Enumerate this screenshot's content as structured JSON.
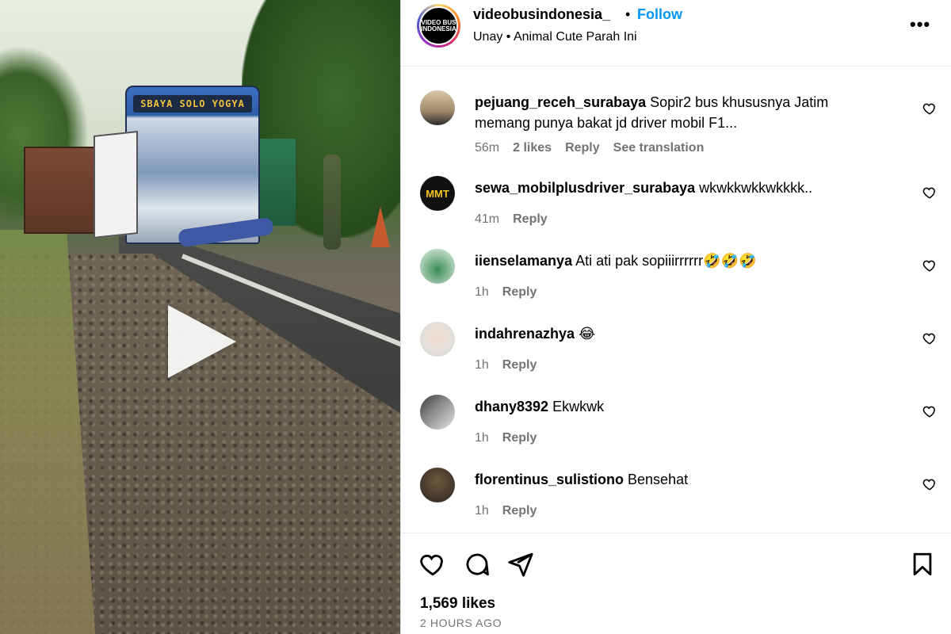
{
  "post": {
    "username": "videobusindonesia_",
    "separator": "•",
    "follow_label": "Follow",
    "audio": "Unay • Animal Cute Parah Ini",
    "avatar_text": "VIDEO BUS INDONESIA",
    "more_label": "•••",
    "bus_sign": "SBAYA SOLO YOGYA"
  },
  "comments": [
    {
      "user": "pejuang_receh_surabaya",
      "text": "Sopir2 bus khususnya Jatim memang punya bakat jd driver mobil F1...",
      "time": "56m",
      "likes": "2 likes",
      "reply": "Reply",
      "translate": "See translation",
      "avatar_color": "#b9a98a",
      "avatar_text": ""
    },
    {
      "user": "sewa_mobilplusdriver_surabaya",
      "text": "wkwkkwkkwkkkk..",
      "time": "41m",
      "reply": "Reply",
      "avatar_color": "#111111",
      "avatar_text": "MMT"
    },
    {
      "user": "iienselamanya",
      "text": "Ati ati pak sopiiirrrrrr🤣🤣🤣",
      "time": "1h",
      "reply": "Reply",
      "avatar_color": "#8fb59a",
      "avatar_text": ""
    },
    {
      "user": "indahrenazhya",
      "text": "😂",
      "time": "1h",
      "reply": "Reply",
      "avatar_color": "#e8e2de",
      "avatar_text": ""
    },
    {
      "user": "dhany8392",
      "text": "Ekwkwk",
      "time": "1h",
      "reply": "Reply",
      "avatar_color": "#6d6d6d",
      "avatar_text": ""
    },
    {
      "user": "florentinus_sulistiono",
      "text": "Bensehat",
      "time": "1h",
      "reply": "Reply",
      "avatar_color": "#4a3a2e",
      "avatar_text": ""
    }
  ],
  "footer": {
    "likes": "1,569 likes",
    "time": "2 HOURS AGO"
  }
}
